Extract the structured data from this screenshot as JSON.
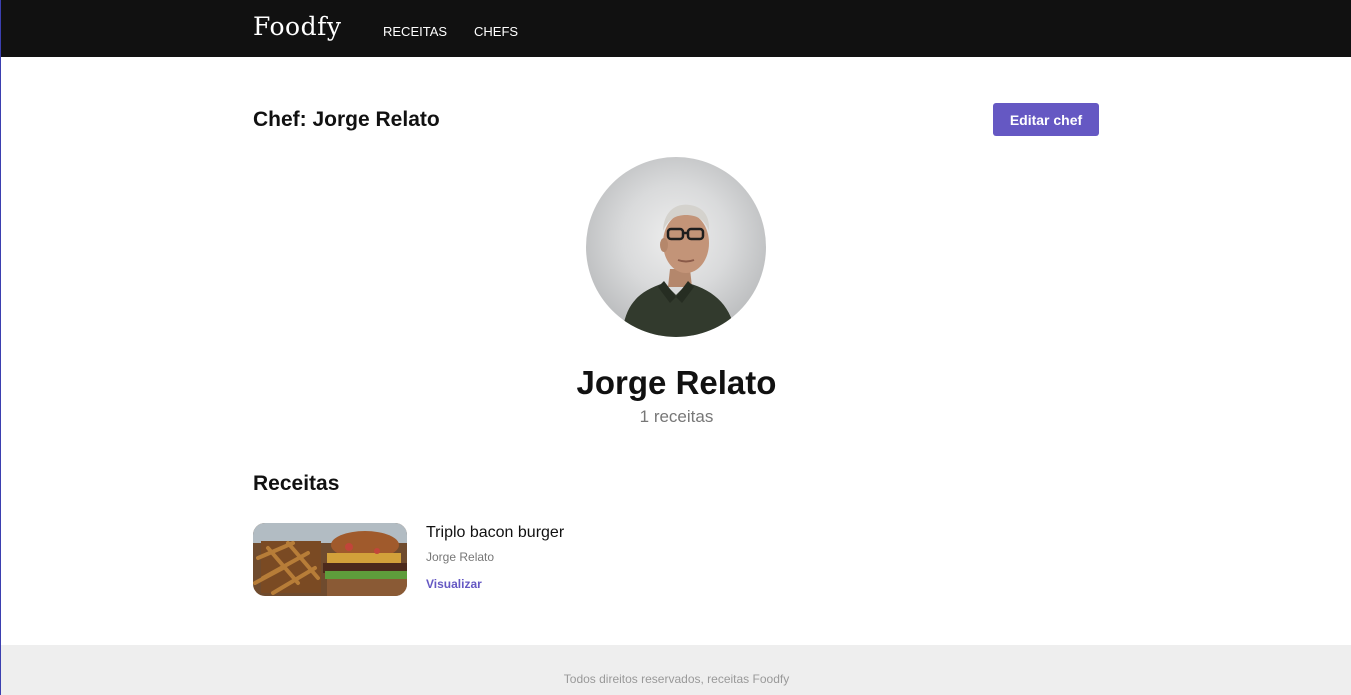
{
  "header": {
    "logo": "Foodfy",
    "nav": [
      {
        "label": "RECEITAS"
      },
      {
        "label": "CHEFS"
      }
    ]
  },
  "page": {
    "title": "Chef: Jorge Relato",
    "edit_button": "Editar chef"
  },
  "chef": {
    "name": "Jorge Relato",
    "recipe_count": "1 receitas"
  },
  "recipes_section": {
    "title": "Receitas",
    "items": [
      {
        "title": "Triplo bacon burger",
        "author": "Jorge Relato",
        "link": "Visualizar"
      }
    ]
  },
  "footer": {
    "text": "Todos direitos reservados, receitas Foodfy"
  },
  "colors": {
    "topbar": "#111111",
    "accent": "#6558c3",
    "footer_bg": "#eeeeee"
  }
}
